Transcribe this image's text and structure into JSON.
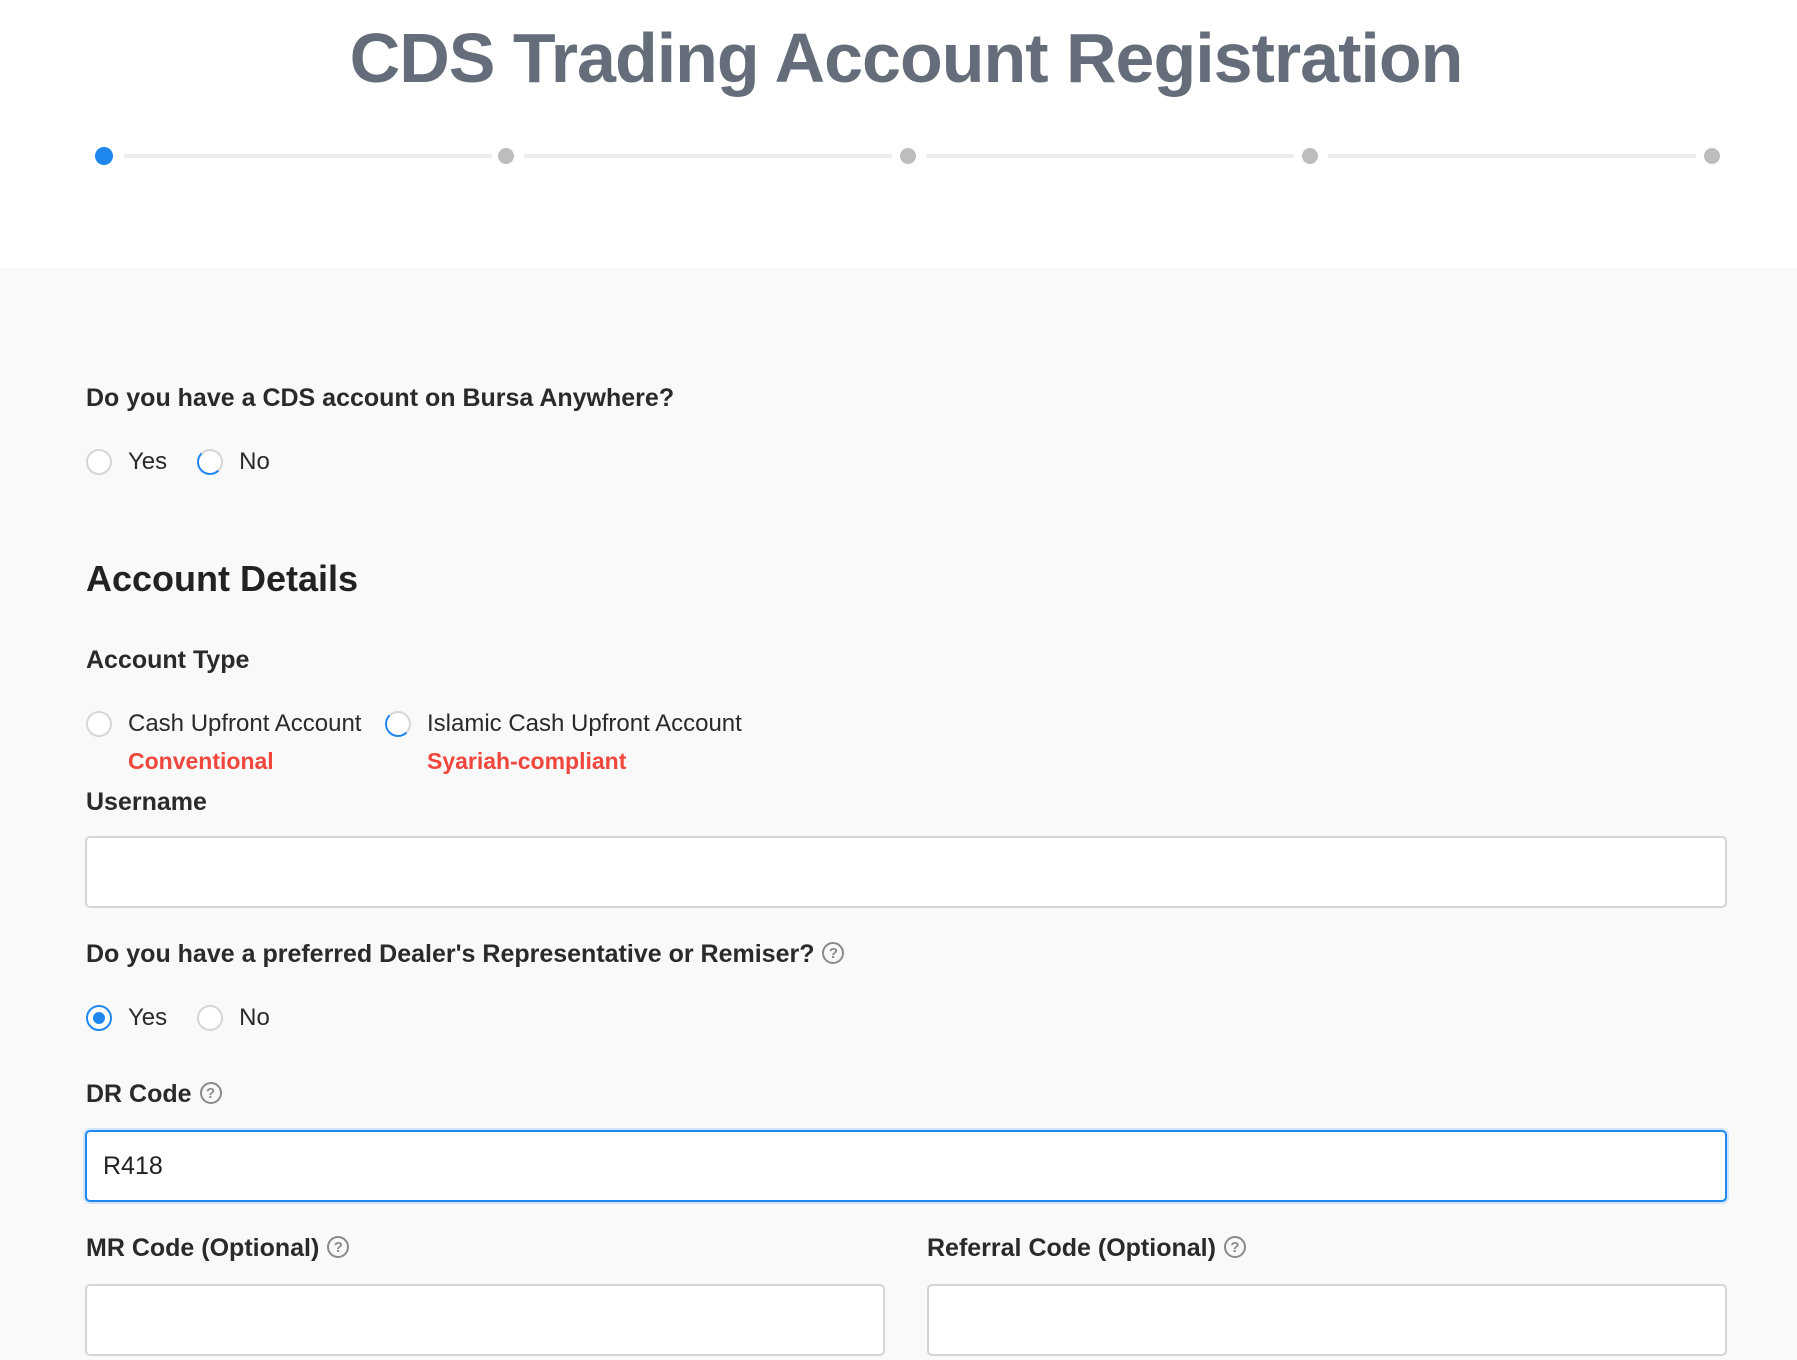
{
  "page": {
    "title": "CDS Trading Account Registration"
  },
  "stepper": {
    "total_steps": 5,
    "current_step": 1,
    "active_color": "#1e88f0",
    "inactive_color": "#bdbdbd"
  },
  "cds_question": {
    "label": "Do you have a CDS account on Bursa Anywhere?",
    "options": [
      "Yes",
      "No"
    ],
    "selected": null
  },
  "account_details": {
    "heading": "Account Details",
    "account_type": {
      "label": "Account Type",
      "options": [
        {
          "label": "Cash Upfront Account",
          "sublabel": "Conventional"
        },
        {
          "label": "Islamic Cash Upfront Account",
          "sublabel": "Syariah-compliant"
        }
      ],
      "selected": null
    },
    "username": {
      "label": "Username",
      "value": "",
      "placeholder": ""
    }
  },
  "dealer_question": {
    "label": "Do you have a preferred Dealer's Representative or Remiser?",
    "help_icon": "question-circle-icon",
    "options": [
      "Yes",
      "No"
    ],
    "selected": "Yes"
  },
  "dr_code": {
    "label": "DR Code",
    "help_icon": "question-circle-icon",
    "value": "R418"
  },
  "mr_code": {
    "label": "MR Code (Optional)",
    "help_icon": "question-circle-icon",
    "value": ""
  },
  "referral_code": {
    "label": "Referral Code (Optional)",
    "help_icon": "question-circle-icon",
    "value": ""
  },
  "colors": {
    "accent": "#1e88f0",
    "subtitle_red": "#f0463c",
    "title_gray": "#646d79"
  }
}
